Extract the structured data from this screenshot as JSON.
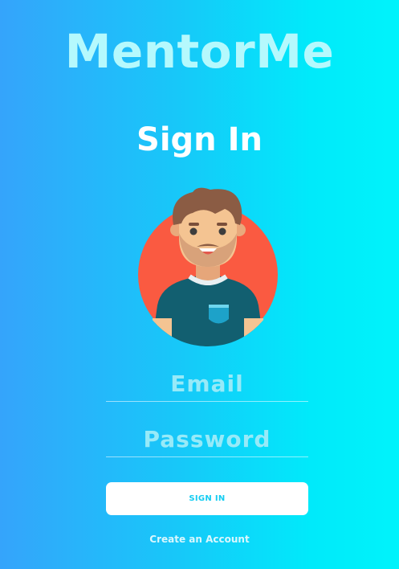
{
  "app": {
    "title": "MentorMe"
  },
  "page": {
    "title": "Sign In"
  },
  "avatar": {
    "icon": "user-avatar-icon"
  },
  "form": {
    "email": {
      "value": "",
      "placeholder": "Email"
    },
    "password": {
      "value": "",
      "placeholder": "Password"
    },
    "submit_label": "SIGN IN"
  },
  "links": {
    "create_account": "Create an Account"
  },
  "colors": {
    "gradient_start": "#35a4fb",
    "gradient_end": "#00f3fb",
    "title": "#b5f9fd",
    "button_text": "#14cdf2",
    "avatar_circle": "#fa5a41"
  }
}
